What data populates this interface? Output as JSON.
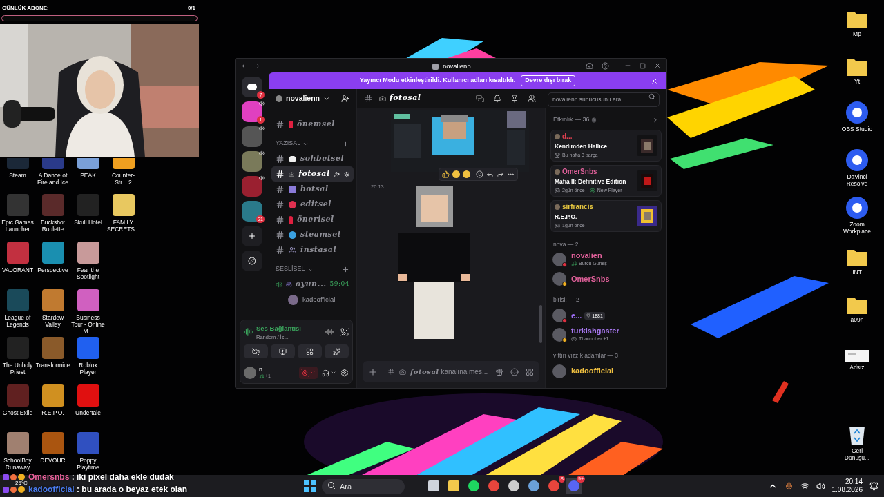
{
  "overlay": {
    "goal": {
      "label": "GÜNLÜK ABONE:",
      "count": "0/1",
      "level": 0
    },
    "weather": "25°C",
    "chat": [
      {
        "user": "Omersnbs",
        "color": "#e8609a",
        "text": ": iki pixel daha ekle dudak"
      },
      {
        "user": "kadoofficial",
        "color": "#4a7cf0",
        "text": ": bu arada o beyaz etek olan"
      }
    ]
  },
  "desktop": {
    "left_rows": [
      {
        "icons": [
          {
            "label": "Steam"
          },
          {
            "label": "A Dance of Fire and Ice"
          },
          {
            "label": "PEAK"
          },
          {
            "label": "Counter-Str... 2"
          }
        ]
      },
      {
        "icons": [
          {
            "label": "Epic Games Launcher"
          },
          {
            "label": "Buckshot Roulette"
          },
          {
            "label": "Skull Hotel"
          },
          {
            "label": "FAMILY SECRETS..."
          }
        ]
      },
      {
        "icons": [
          {
            "label": "VALORANT"
          },
          {
            "label": "Perspective"
          },
          {
            "label": "Fear the Spotlight"
          }
        ]
      },
      {
        "icons": [
          {
            "label": "League of Legends"
          },
          {
            "label": "Stardew Valley"
          },
          {
            "label": "Business Tour - Online M..."
          }
        ]
      },
      {
        "icons": [
          {
            "label": "The Unholy Priest"
          },
          {
            "label": "Transformice"
          },
          {
            "label": "Roblox Player"
          }
        ]
      },
      {
        "icons": [
          {
            "label": "Ghost Exile"
          },
          {
            "label": "R.E.P.O."
          },
          {
            "label": "Undertale"
          }
        ]
      },
      {
        "icons": [
          {
            "label": "SchoolBoy Runaway"
          },
          {
            "label": "DEVOUR"
          },
          {
            "label": "Poppy Playtime"
          }
        ]
      }
    ],
    "right_icons": [
      {
        "kind": "folder",
        "label": "Mp"
      },
      {
        "kind": "folder",
        "label": "Yt"
      },
      {
        "kind": "app",
        "label": "OBS Studio"
      },
      {
        "kind": "app",
        "label": "DaVinci Resolve"
      },
      {
        "kind": "app",
        "label": "Zoom Workplace"
      },
      {
        "kind": "folder",
        "label": "INT"
      },
      {
        "kind": "folder",
        "label": "a09n"
      },
      {
        "kind": "file",
        "label": "Adsız"
      },
      {
        "kind": "bin",
        "label": "Geri Dönüşü..."
      }
    ]
  },
  "discord": {
    "title": "novalienn",
    "banner": {
      "text": "Yayıncı Modu etkinleştirildi. Kullanıcı adları kısaltıldı.",
      "button": "Devre dışı bırak"
    },
    "servers": [
      {
        "kind": "home",
        "badge": "7",
        "voice": false
      },
      {
        "kind": "server",
        "badge": "1",
        "voice": true
      },
      {
        "kind": "server",
        "voice": true
      },
      {
        "kind": "server",
        "voice": true
      },
      {
        "kind": "server",
        "voice": true
      },
      {
        "kind": "server",
        "badge": "21",
        "voice": false
      }
    ],
    "server_name": "novalienn",
    "channels": [
      {
        "kind": "text",
        "name": "önemsel",
        "selected": false
      },
      {
        "kind": "category",
        "name": "YAZISAL"
      },
      {
        "kind": "text",
        "name": "sohbetsel",
        "selected": false
      },
      {
        "kind": "text",
        "name": "fotosal",
        "selected": true
      },
      {
        "kind": "text",
        "name": "botsal",
        "selected": false
      },
      {
        "kind": "text",
        "name": "editsel",
        "selected": false
      },
      {
        "kind": "text",
        "name": "önerisel",
        "selected": false
      },
      {
        "kind": "text",
        "name": "steamsel",
        "selected": false
      },
      {
        "kind": "text",
        "name": "instasal",
        "selected": false
      },
      {
        "kind": "category",
        "name": "SESLİSEL"
      },
      {
        "kind": "voice",
        "name": "oyun...",
        "time": "59:04"
      },
      {
        "kind": "member",
        "name": "kadoofficial"
      }
    ],
    "voice_panel": {
      "status": "Ses Bağlantısı",
      "channel": "Random / İsi..."
    },
    "user_panel": {
      "name": "n...",
      "activity": "+1",
      "mic_muted": true
    },
    "chat": {
      "channel": "fotosal",
      "message_time": "20:13",
      "input_channel": "fotosal",
      "input_placeholder": "kanalına mes..."
    },
    "search": {
      "placeholder": "novalienn sunucusunu ara"
    },
    "activity": {
      "title": "Etkinlik — 36",
      "cards": [
        {
          "user": "d...",
          "color": "#e04050",
          "title": "Kendimden Hallice",
          "details": [
            {
              "kind": "trophy",
              "text": "Bu hafta 3 parça"
            }
          ]
        },
        {
          "user": "OmerSnbs",
          "color": "#e0609a",
          "title": "Mafia II: Definitive Edition",
          "details": [
            {
              "kind": "game",
              "text": "2gün önce"
            },
            {
              "kind": "player",
              "text": "New Player"
            }
          ]
        },
        {
          "user": "sirfrancis",
          "color": "#e8c840",
          "title": "R.E.P.O.",
          "details": [
            {
              "kind": "game",
              "text": "1gün önce"
            }
          ]
        }
      ]
    },
    "member_groups": [
      {
        "title": "nova — 2",
        "members": [
          {
            "name": "novalien",
            "color": "#e0609a",
            "dnd": true,
            "activity": {
              "kind": "music",
              "text": "Burcu Güneş"
            }
          },
          {
            "name": "OmerSnbs",
            "color": "#e0609a",
            "dnd": false
          }
        ]
      },
      {
        "title": "birisi! — 2",
        "members": [
          {
            "name": "e...",
            "color": "#9b6cf0",
            "dnd": true,
            "badge": "1881"
          },
          {
            "name": "turkishgaster",
            "color": "#a878f0",
            "dnd": false,
            "activity": {
              "kind": "game",
              "text": "TLauncher +1"
            }
          }
        ]
      },
      {
        "title": "vıttırı vızzık adamlar — 3",
        "members": [
          {
            "name": "kadoofficial",
            "color": "#f0c040"
          }
        ]
      }
    ]
  },
  "taskbar": {
    "search_placeholder": "Ara",
    "time": "20:14",
    "date": "1.08.2026",
    "apps": [
      {
        "kind": "taskview",
        "selected": false
      },
      {
        "kind": "folder",
        "selected": false
      },
      {
        "kind": "music",
        "selected": false
      },
      {
        "kind": "browser",
        "selected": false
      },
      {
        "kind": "recorder",
        "selected": false
      },
      {
        "kind": "tool",
        "selected": false
      },
      {
        "kind": "browser",
        "selected": false,
        "badge": "S"
      },
      {
        "kind": "chat",
        "selected": true,
        "badge": "9+"
      }
    ]
  }
}
